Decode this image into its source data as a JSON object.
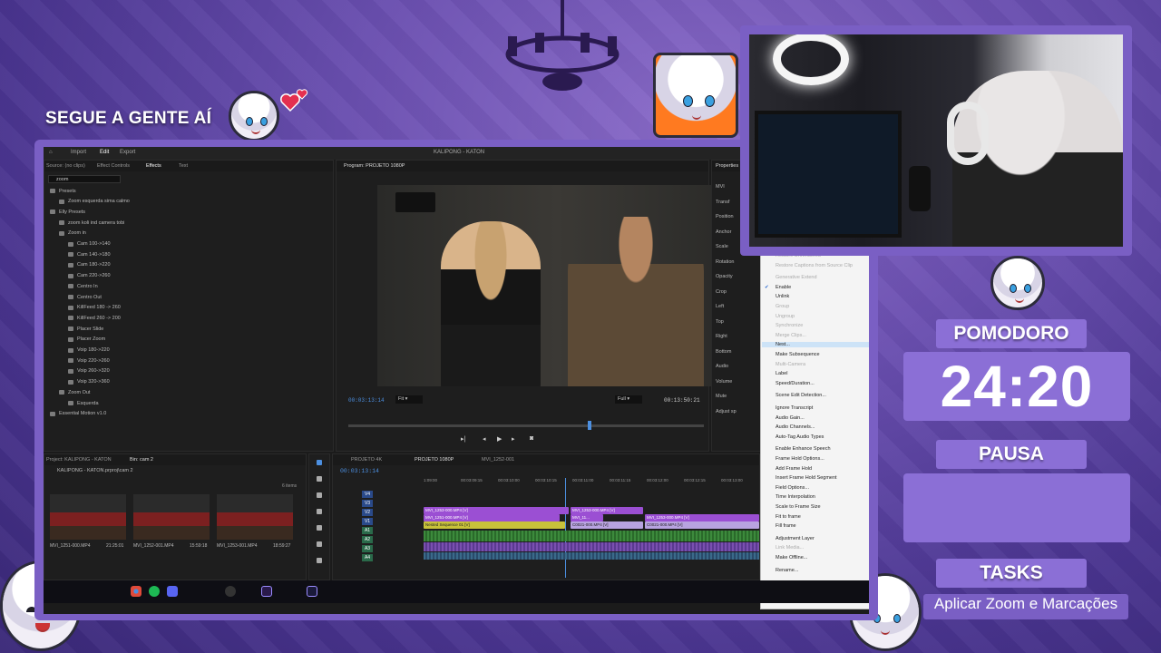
{
  "overlay": {
    "follow_text": "SEGUE A GENTE AÍ",
    "pomodoro_label": "POMODORO",
    "timer": "24:20",
    "status": "PAUSA",
    "tasks_label": "TASKS",
    "task": "Aplicar Zoom e Marcações"
  },
  "editor": {
    "menu": {
      "home": "⌂",
      "import": "Import",
      "edit": "Edit",
      "export": "Export",
      "title": "KALIPONG - KATON"
    },
    "effects_panel": {
      "tabs": [
        "Source: (no clips)",
        "Effect Controls",
        "Effects",
        "Text"
      ],
      "search": "zoom",
      "tree": [
        "Presets",
        "Zoom esquerda sima calmo",
        "Elly Presets",
        "zoom koli ind camera tobi",
        "Zoom in",
        "Cam 100->140",
        "Cam 140->180",
        "Cam 180->220",
        "Cam 220->260",
        "Centro In",
        "Centro Out",
        "KillFeed 180 -> 260",
        "KillFeed 260 -> 200",
        "Placer Slide",
        "Placer Zoom",
        "Voip 180->220",
        "Voip 220->260",
        "Voip 260->320",
        "Voip 320->360",
        "Zoom Out",
        "Esquerda",
        "Essential Motion v1.0"
      ]
    },
    "program": {
      "tab": "Program: PROJETO 1080P",
      "timecode": "00:03:13:14",
      "fit": "Fit",
      "full": "Full",
      "duration": "00:13:50:21"
    },
    "properties": {
      "tab": "Properties",
      "items": [
        "MVI",
        "Transf",
        "Position",
        "Anchor",
        "Scale",
        "Rotation",
        "Opacity",
        "Crop",
        "Left",
        "Top",
        "Right",
        "Bottom",
        "Audio",
        "Volume",
        "Mute",
        "Adjust sp"
      ]
    },
    "project": {
      "tab": "Project: KALIPONG - KATON",
      "bin_tab": "Bin: cam 2",
      "path": "KALIPONG - KATON.prproj\\cam 2",
      "items_count": "6 items",
      "clips": [
        {
          "name": "MVI_1251-000.MP4",
          "duration": "21:25:01"
        },
        {
          "name": "MVI_1252-001.MP4",
          "duration": "15:59:18"
        },
        {
          "name": "MVI_1253-001.MP4",
          "duration": "18:59:27"
        }
      ]
    },
    "timeline": {
      "tabs": [
        "PROJETO 4K",
        "PROJETO 1080P",
        "MVI_1252-001"
      ],
      "timecode": "00:03:13:14",
      "ruler": [
        "1:09:00",
        "00:03:09:15",
        "00:03:10:00",
        "00:03:10:15",
        "00:03:11:00",
        "00:03:11:15",
        "00:03:12:00",
        "00:03:12:15",
        "00:03:13:00"
      ],
      "tracks": [
        "V4",
        "V3",
        "V2",
        "V1",
        "A1",
        "A2",
        "A3",
        "A4"
      ],
      "clips": [
        "MVI_1253-000.MP4 [V]",
        "MVI_1251-000.MP4 [V]",
        "Nested Sequence 01 [V]",
        "MVI_1253-000.MP4 [V]",
        "MVI_11...",
        "C0021-000.MP4 [V]",
        "MVI_1253-000.MP4 [V]",
        "C0021-000.MP4 [V]"
      ]
    },
    "context_menu": [
      {
        "label": "Restore Unrendered",
        "disabled": true
      },
      {
        "label": "Restore Captions from Source Clip",
        "disabled": true
      },
      {
        "label": "Generative Extend",
        "disabled": true
      },
      {
        "label": "Enable",
        "checked": true
      },
      {
        "label": "Unlink"
      },
      {
        "label": "Group",
        "disabled": true
      },
      {
        "label": "Ungroup",
        "disabled": true
      },
      {
        "label": "Synchronize",
        "disabled": true
      },
      {
        "label": "Merge Clips...",
        "disabled": true
      },
      {
        "label": "Nest...",
        "selected": true
      },
      {
        "label": "Make Subsequence"
      },
      {
        "label": "Multi-Camera",
        "disabled": true
      },
      {
        "label": "Label"
      },
      {
        "label": "Speed/Duration..."
      },
      {
        "label": "Scene Edit Detection..."
      },
      {
        "label": "Ignore Transcript"
      },
      {
        "label": "Audio Gain..."
      },
      {
        "label": "Audio Channels..."
      },
      {
        "label": "Auto-Tag Audio Types"
      },
      {
        "label": "Enable Enhance Speech"
      },
      {
        "label": "Frame Hold Options..."
      },
      {
        "label": "Add Frame Hold"
      },
      {
        "label": "Insert Frame Hold Segment"
      },
      {
        "label": "Field Options..."
      },
      {
        "label": "Time Interpolation"
      },
      {
        "label": "Scale to Frame Size"
      },
      {
        "label": "Fit to frame"
      },
      {
        "label": "Fill frame"
      },
      {
        "label": "Adjustment Layer"
      },
      {
        "label": "Link Media...",
        "disabled": true
      },
      {
        "label": "Make Offline..."
      },
      {
        "label": "Rename..."
      }
    ],
    "taskbar_apps": [
      "chrome",
      "spotify",
      "discord",
      "obs",
      "premiere",
      "after-effects"
    ]
  },
  "colors": {
    "accent": "#8b6fd6",
    "bg": "#4a3590",
    "timecode_blue": "#4c8fe0"
  }
}
